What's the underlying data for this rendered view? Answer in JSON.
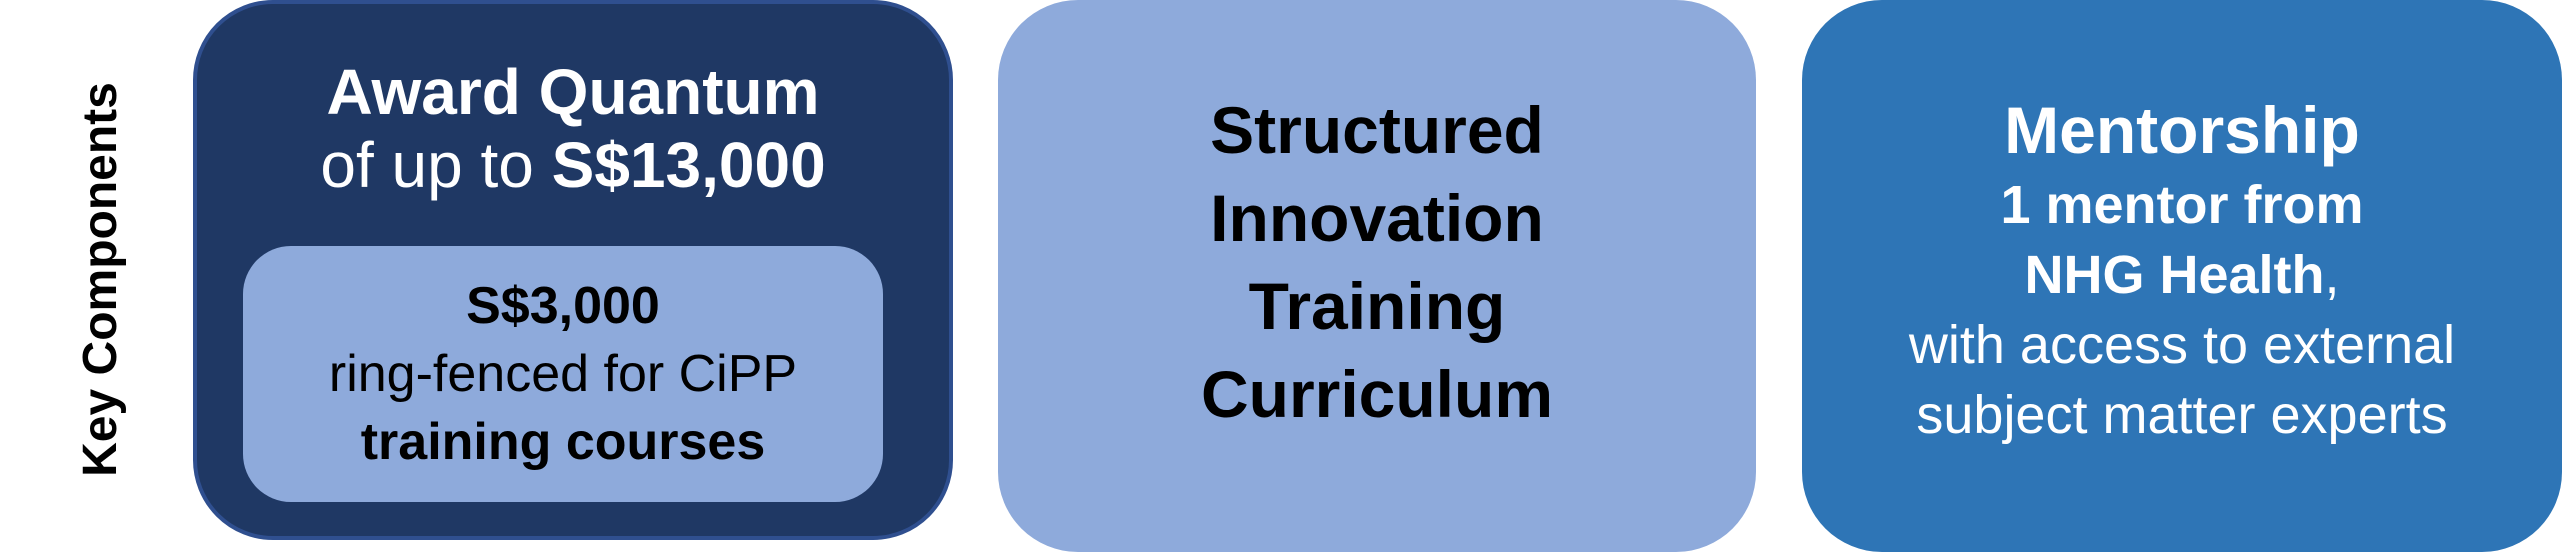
{
  "side_label": "Key Components",
  "award": {
    "title": "Award Quantum",
    "prefix": "of up to ",
    "amount": "S$13,000",
    "inner": {
      "amount": "S$3,000",
      "line2": "ring-fenced for CiPP",
      "line3": "training courses"
    }
  },
  "curriculum": {
    "lines": [
      "Structured",
      "Innovation",
      "Training",
      "Curriculum"
    ]
  },
  "mentorship": {
    "title": "Mentorship",
    "line1": "1 mentor from",
    "line2_bold": "NHG Health",
    "line2_suffix": ",",
    "line3": "with access to external",
    "line4": "subject matter experts"
  },
  "colors": {
    "award_box": "#1f3864",
    "inner_box": "#8eaadb",
    "curriculum_box": "#8eaadb",
    "mentorship_box": "#2e75b6"
  }
}
